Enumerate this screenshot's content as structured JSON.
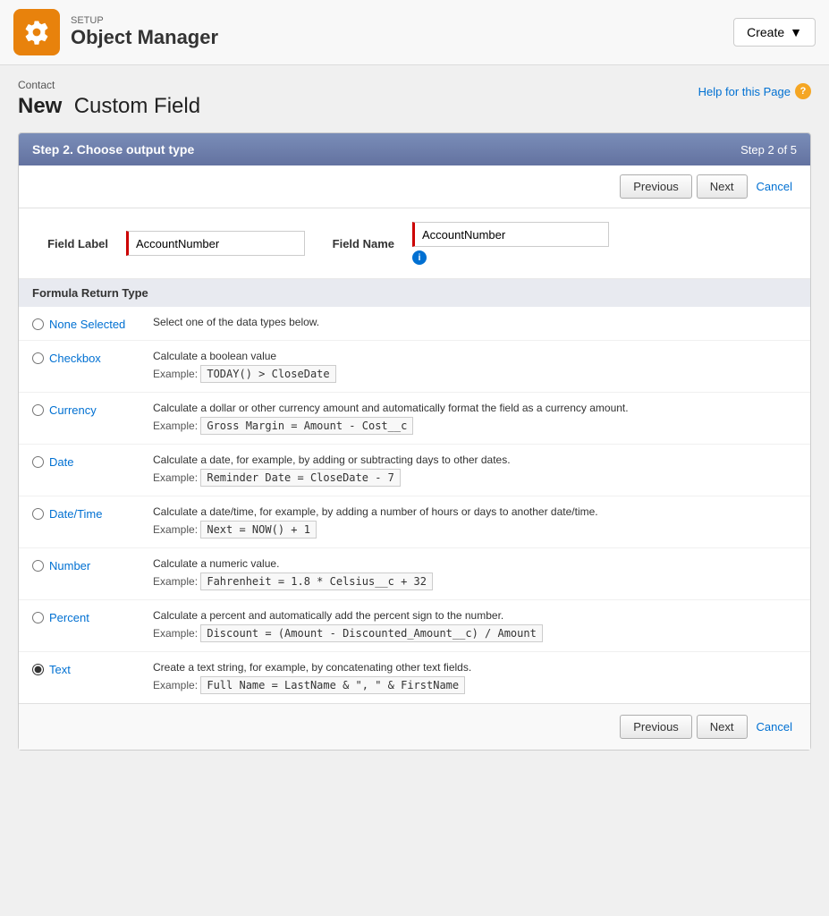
{
  "header": {
    "setup_label": "SETUP",
    "title": "Object Manager",
    "create_button": "Create"
  },
  "page": {
    "contact_label": "Contact",
    "heading_new": "New",
    "heading_rest": "Custom Field",
    "help_link": "Help for this Page"
  },
  "step": {
    "title": "Step 2. Choose output type",
    "count": "Step 2 of 5"
  },
  "buttons": {
    "previous": "Previous",
    "next": "Next",
    "cancel": "Cancel"
  },
  "fields": {
    "field_label": "Field Label",
    "field_label_value": "AccountNumber",
    "field_name": "Field Name",
    "field_name_value": "AccountNumber"
  },
  "formula_section": {
    "title": "Formula Return Type",
    "options": [
      {
        "id": "none",
        "label": "None Selected",
        "description": "Select one of the data types below.",
        "example": null,
        "checked": false
      },
      {
        "id": "checkbox",
        "label": "Checkbox",
        "description": "Calculate a boolean value",
        "example_label": "Example:",
        "example": "TODAY() > CloseDate",
        "checked": false
      },
      {
        "id": "currency",
        "label": "Currency",
        "description": "Calculate a dollar or other currency amount and automatically format the field as a currency amount.",
        "example_label": "Example:",
        "example": "Gross Margin = Amount - Cost__c",
        "checked": false
      },
      {
        "id": "date",
        "label": "Date",
        "description": "Calculate a date, for example, by adding or subtracting days to other dates.",
        "example_label": "Example:",
        "example": "Reminder Date = CloseDate - 7",
        "checked": false
      },
      {
        "id": "datetime",
        "label": "Date/Time",
        "description": "Calculate a date/time, for example, by adding a number of hours or days to another date/time.",
        "example_label": "Example:",
        "example": "Next = NOW() + 1",
        "checked": false
      },
      {
        "id": "number",
        "label": "Number",
        "description": "Calculate a numeric value.",
        "example_label": "Example:",
        "example": "Fahrenheit = 1.8 * Celsius__c + 32",
        "checked": false
      },
      {
        "id": "percent",
        "label": "Percent",
        "description": "Calculate a percent and automatically add the percent sign to the number.",
        "example_label": "Example:",
        "example": "Discount = (Amount - Discounted_Amount__c) / Amount",
        "checked": false
      },
      {
        "id": "text",
        "label": "Text",
        "description": "Create a text string, for example, by concatenating other text fields.",
        "example_label": "Example:",
        "example": "Full Name = LastName & \", \" & FirstName",
        "checked": true
      }
    ]
  }
}
